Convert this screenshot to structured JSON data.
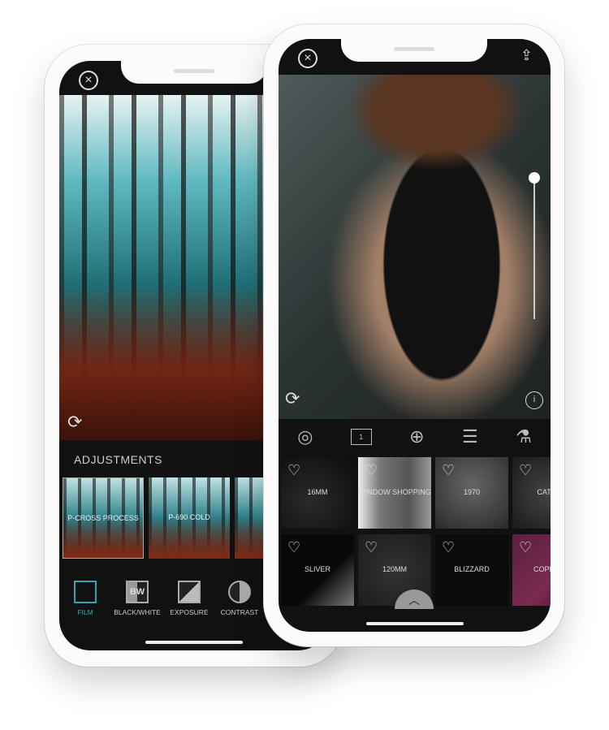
{
  "left_phone": {
    "section_title": "ADJUSTMENTS",
    "presets": [
      "P-CROSS PROCESS",
      "P-690 COLD",
      ""
    ],
    "tools": [
      {
        "label": "FILM",
        "icon": "film-icon",
        "active": true
      },
      {
        "label": "BLACK/WHITE",
        "icon": "bw-icon"
      },
      {
        "label": "EXPOSURE",
        "icon": "exposure-icon"
      },
      {
        "label": "CONTRAST",
        "icon": "contrast-icon"
      }
    ],
    "accent": "#3aa3b3"
  },
  "right_phone": {
    "layer_count": "1",
    "info_badge": "i",
    "bw_label": "BW",
    "filters": [
      {
        "label": "16MM"
      },
      {
        "label": "WINDOW SHOPPING"
      },
      {
        "label": "1970"
      },
      {
        "label": "CATAR"
      },
      {
        "label": "SLIVER"
      },
      {
        "label": "120MM"
      },
      {
        "label": "BLIZZARD"
      },
      {
        "label": "COPPER"
      }
    ]
  }
}
